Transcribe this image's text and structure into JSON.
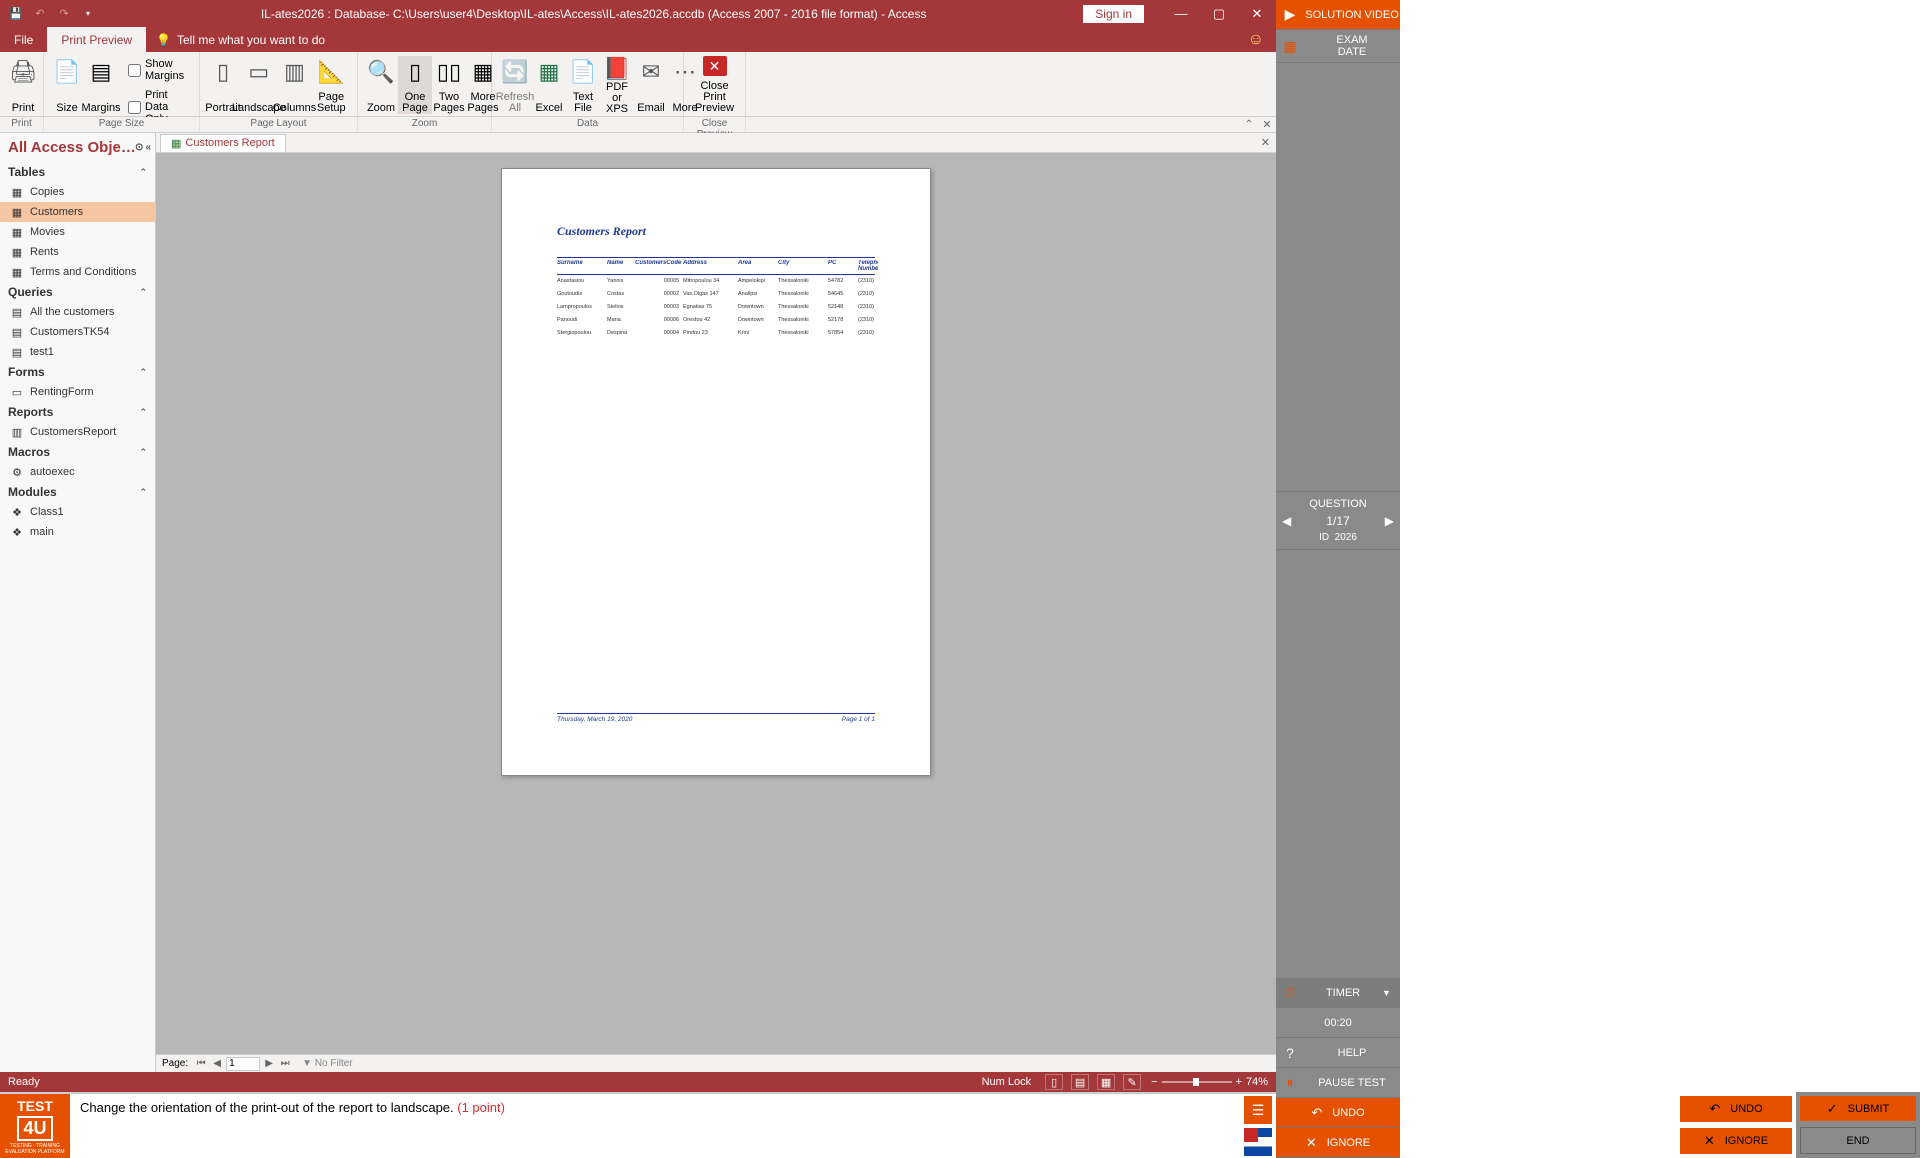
{
  "titlebar": {
    "title": "IL-ates2026 : Database- C:\\Users\\user4\\Desktop\\IL-ates\\Access\\IL-ates2026.accdb (Access 2007 - 2016 file format)  -  Access",
    "signin": "Sign in"
  },
  "tabs": {
    "file": "File",
    "printpreview": "Print Preview",
    "tellme": "Tell me what you want to do"
  },
  "ribbon": {
    "print": "Print",
    "size": "Size",
    "margins": "Margins",
    "show_margins": "Show Margins",
    "print_data_only": "Print Data Only",
    "portrait": "Portrait",
    "landscape": "Landscape",
    "columns": "Columns",
    "page_setup": "Page Setup",
    "zoom": "Zoom",
    "one_page": "One Page",
    "two_pages": "Two Pages",
    "more_pages": "More Pages",
    "refresh_all": "Refresh All",
    "excel": "Excel",
    "text_file": "Text File",
    "pdf_xps": "PDF or XPS",
    "email": "Email",
    "more": "More",
    "close_print_preview": "Close Print Preview",
    "grp_print": "Print",
    "grp_page_size": "Page Size",
    "grp_page_layout": "Page Layout",
    "grp_zoom": "Zoom",
    "grp_data": "Data",
    "grp_close": "Close Preview"
  },
  "nav": {
    "header": "All Access Obje…",
    "groups": {
      "tables": "Tables",
      "queries": "Queries",
      "forms": "Forms",
      "reports": "Reports",
      "macros": "Macros",
      "modules": "Modules"
    },
    "tables_items": [
      "Copies",
      "Customers",
      "Movies",
      "Rents",
      "Terms and Conditions"
    ],
    "queries_items": [
      "All the customers",
      "CustomersTK54",
      "test1"
    ],
    "forms_items": [
      "RentingForm"
    ],
    "reports_items": [
      "CustomersReport"
    ],
    "macros_items": [
      "autoexec"
    ],
    "modules_items": [
      "Class1",
      "main"
    ]
  },
  "doc": {
    "tab": "Customers Report",
    "report_title": "Customers Report",
    "headers": {
      "surname": "Surname",
      "name": "Name",
      "code": "CustomersCode",
      "address": "Address",
      "area": "Area",
      "city": "City",
      "pc": "PC",
      "tel": "Telephone Number"
    },
    "rows": [
      {
        "surname": "Anastasiou",
        "name": "Yannis",
        "code": "00005",
        "address": "Mitropoulou 34",
        "area": "Ampelokipi",
        "city": "Thessaloniki",
        "pc": "54782",
        "tel": "(2310)"
      },
      {
        "surname": "Goutoudis",
        "name": "Costas",
        "code": "00002",
        "address": "Vas.Olgas 147",
        "area": "Analipsi",
        "city": "Thessaloniki",
        "pc": "54645",
        "tel": "(2310)"
      },
      {
        "surname": "Lampropoulos",
        "name": "Stelios",
        "code": "00003",
        "address": "Egnatias 75",
        "area": "Downtown",
        "city": "Thessaloniki",
        "pc": "52148",
        "tel": "(2310)"
      },
      {
        "surname": "Panoudi",
        "name": "Maria",
        "code": "00006",
        "address": "Orestou 42",
        "area": "Downtown",
        "city": "Thessaloniki",
        "pc": "52178",
        "tel": "(2310)"
      },
      {
        "surname": "Stergiopoulou",
        "name": "Despina",
        "code": "00004",
        "address": "Pindou 23",
        "area": "Krini",
        "city": "Thessaloniki",
        "pc": "57854",
        "tel": "(2310)"
      }
    ],
    "footer_date": "Thursday, March 19, 2020",
    "footer_page": "Page 1 of 1"
  },
  "pagenav": {
    "label": "Page:",
    "value": "1",
    "nofilter": "No Filter"
  },
  "statusbar": {
    "ready": "Ready",
    "numlock": "Num Lock",
    "zoom": "74%"
  },
  "test": {
    "question": "Change the orientation of the print-out of the report to landscape. ",
    "points": "(1 point)",
    "undo": "UNDO",
    "ignore": "IGNORE",
    "submit": "SUBMIT",
    "end": "END"
  },
  "side": {
    "solution_video": "SOLUTION VIDEO",
    "exam_date_l1": "EXAM",
    "exam_date_l2": "DATE",
    "question": "QUESTION",
    "q_pos": "1/17",
    "q_id_lbl": "ID",
    "q_id": "2026",
    "timer": "TIMER",
    "timer_val": "00:20",
    "help": "HELP",
    "pause": "PAUSE TEST"
  }
}
